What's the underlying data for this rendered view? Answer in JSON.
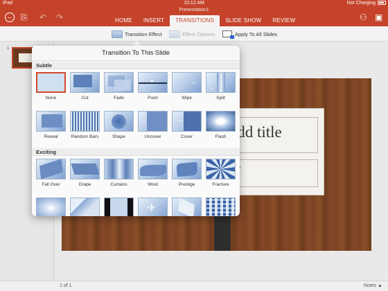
{
  "status_bar": {
    "device": "iPad",
    "time": "10:12 AM",
    "charging": "Not Charging"
  },
  "app": {
    "document_title": "Presentation1"
  },
  "ribbon": {
    "tabs": [
      {
        "label": "HOME",
        "active": false
      },
      {
        "label": "INSERT",
        "active": false
      },
      {
        "label": "TRANSITIONS",
        "active": true
      },
      {
        "label": "SLIDE SHOW",
        "active": false
      },
      {
        "label": "REVIEW",
        "active": false
      }
    ],
    "transition_effect_label": "Transition Effect",
    "effect_options_label": "Effect Options",
    "apply_all_label": "Apply To All Slides"
  },
  "colors": {
    "accent": "#c4432a",
    "selection": "#d2492a"
  },
  "thumbnails": {
    "slide_number": "1"
  },
  "popover": {
    "title": "Transition To This Slide",
    "sections": [
      {
        "header": "Subtle",
        "items": [
          "None",
          "Cut",
          "Fade",
          "Push",
          "Wipe",
          "Split",
          "Reveal",
          "Random Bars",
          "Shape",
          "Uncover",
          "Cover",
          "Flash"
        ]
      },
      {
        "header": "Exciting",
        "items": [
          "Fall Over",
          "Drape",
          "Curtains",
          "Wind",
          "Prestige",
          "Fracture"
        ]
      }
    ],
    "selected": "None"
  },
  "slide": {
    "title_placeholder": "add title",
    "subtitle_placeholder": "ubtitle"
  },
  "footer": {
    "page_indicator": "1 of 1",
    "notes_label": "Notes ▲"
  }
}
